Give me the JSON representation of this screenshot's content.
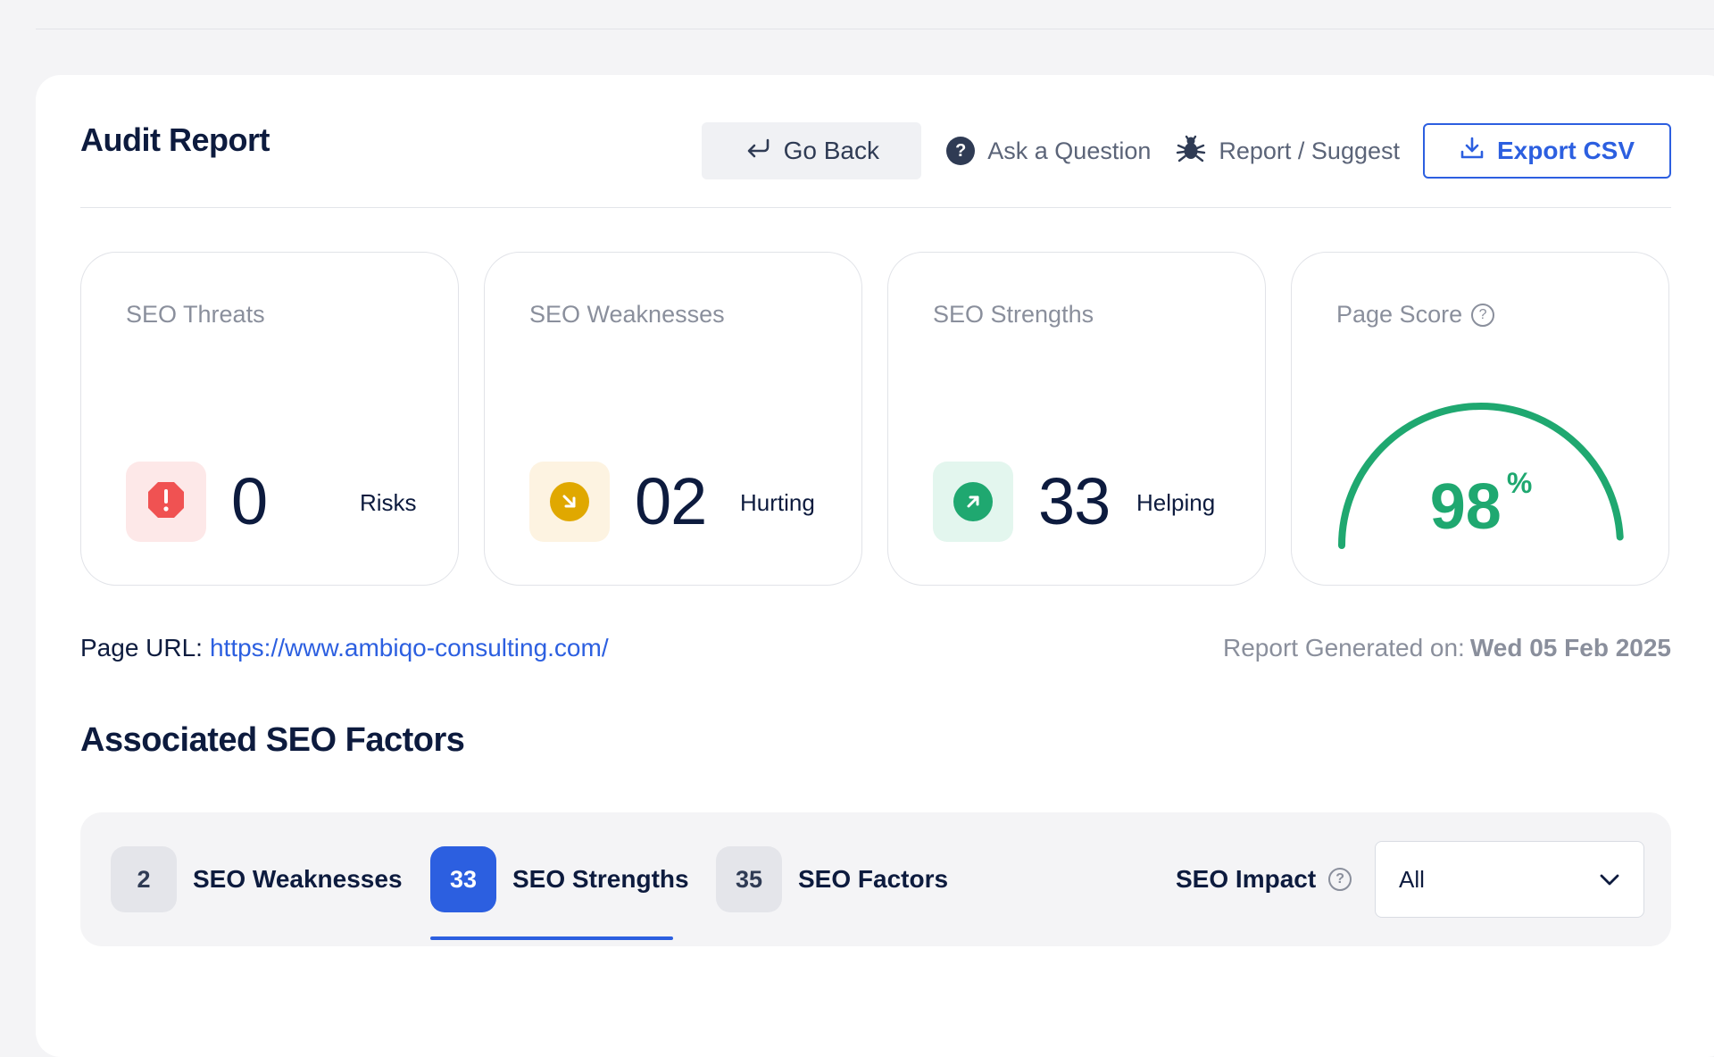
{
  "header": {
    "title": "Audit Report",
    "go_back": "Go Back",
    "ask_question": "Ask a Question",
    "report_suggest": "Report / Suggest",
    "export_csv": "Export CSV"
  },
  "cards": {
    "threats": {
      "label": "SEO Threats",
      "value": "0",
      "word": "Risks",
      "icon": "alert-icon",
      "color": "#f05252"
    },
    "weaknesses": {
      "label": "SEO Weaknesses",
      "value": "02",
      "word": "Hurting",
      "icon": "arrow-down-right-icon",
      "color": "#e0a800"
    },
    "strengths": {
      "label": "SEO Strengths",
      "value": "33",
      "word": "Helping",
      "icon": "arrow-up-right-icon",
      "color": "#1fa870"
    },
    "score": {
      "label": "Page Score",
      "value": "98",
      "unit": "%",
      "percent": 98,
      "help": "?"
    }
  },
  "meta": {
    "url_label": "Page URL:",
    "url": "https://www.ambiqo-consulting.com/",
    "generated_label": "Report Generated on:",
    "generated_date": "Wed 05 Feb 2025"
  },
  "factors": {
    "title": "Associated SEO Factors",
    "tabs": [
      {
        "count": "2",
        "label": "SEO Weaknesses"
      },
      {
        "count": "33",
        "label": "SEO Strengths"
      },
      {
        "count": "35",
        "label": "SEO Factors"
      }
    ],
    "active_tab": "SEO Strengths",
    "impact_label": "SEO Impact",
    "impact_help": "?",
    "impact_value": "All"
  }
}
